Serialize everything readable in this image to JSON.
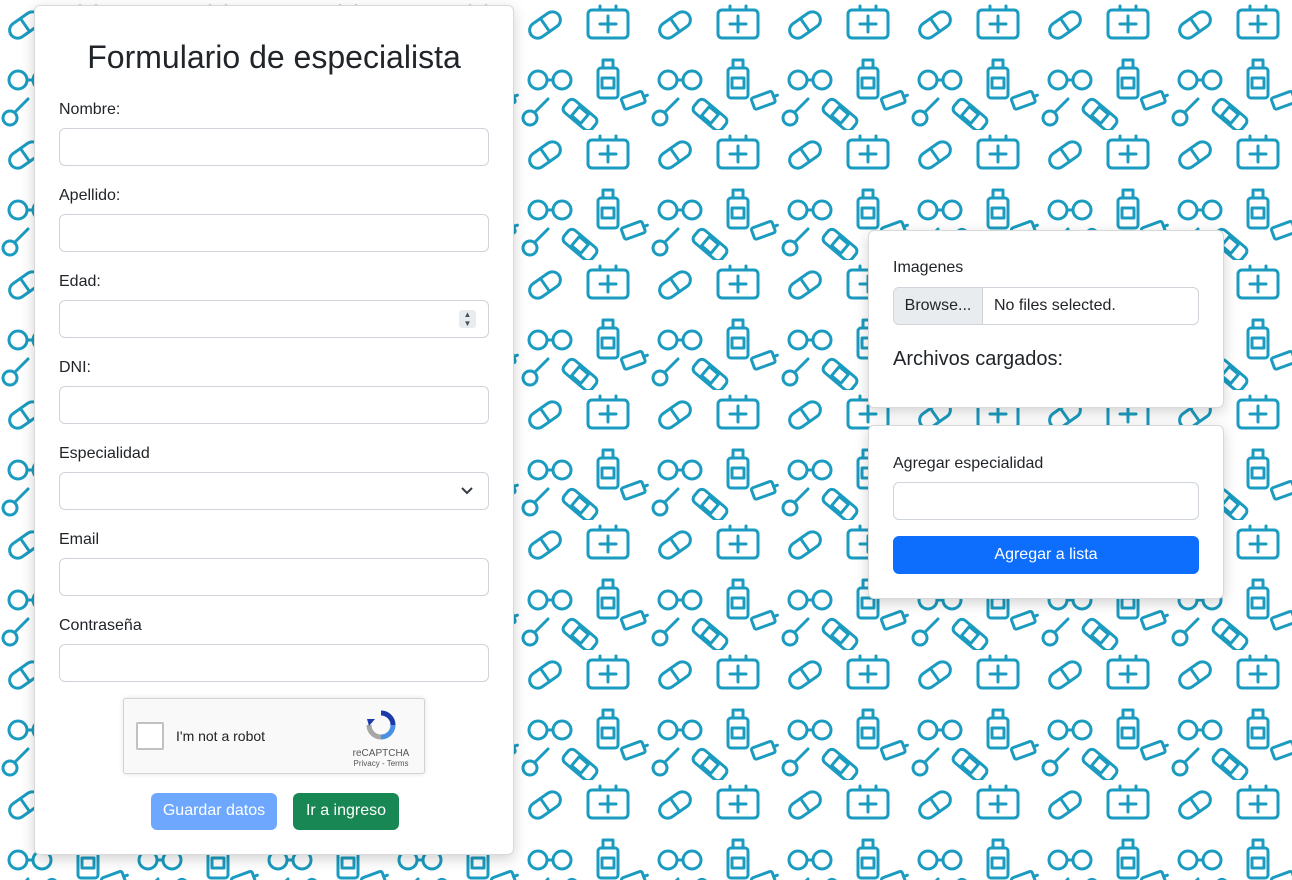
{
  "form": {
    "title": "Formulario de especialista",
    "fields": [
      {
        "label": "Nombre:",
        "value": "",
        "type": "text"
      },
      {
        "label": "Apellido:",
        "value": "",
        "type": "text"
      },
      {
        "label": "Edad:",
        "value": "",
        "type": "number"
      },
      {
        "label": "DNI:",
        "value": "",
        "type": "text"
      },
      {
        "label": "Especialidad",
        "value": "",
        "type": "select"
      },
      {
        "label": "Email",
        "value": "",
        "type": "email"
      },
      {
        "label": "Contraseña",
        "value": "",
        "type": "password"
      }
    ],
    "captcha": {
      "text": "I'm not a robot",
      "brand": "reCAPTCHA",
      "links": "Privacy - Terms"
    },
    "save_label": "Guardar datos",
    "login_label": "Ir a ingreso"
  },
  "upload": {
    "label": "Imagenes",
    "browse_label": "Browse...",
    "status": "No files selected.",
    "uploaded_heading": "Archivos cargados:"
  },
  "specialty": {
    "label": "Agregar especialidad",
    "value": "",
    "add_label": "Agregar a lista"
  },
  "colors": {
    "pattern": "#1a9bbf",
    "primary": "#0d6efd",
    "primary_disabled": "#6ea8fe",
    "success": "#198754"
  },
  "icons": {
    "background": "medical-pattern-icon",
    "captcha": "recaptcha-logo-icon",
    "select": "chevron-down-icon",
    "number": "spinner-arrows-icon"
  }
}
